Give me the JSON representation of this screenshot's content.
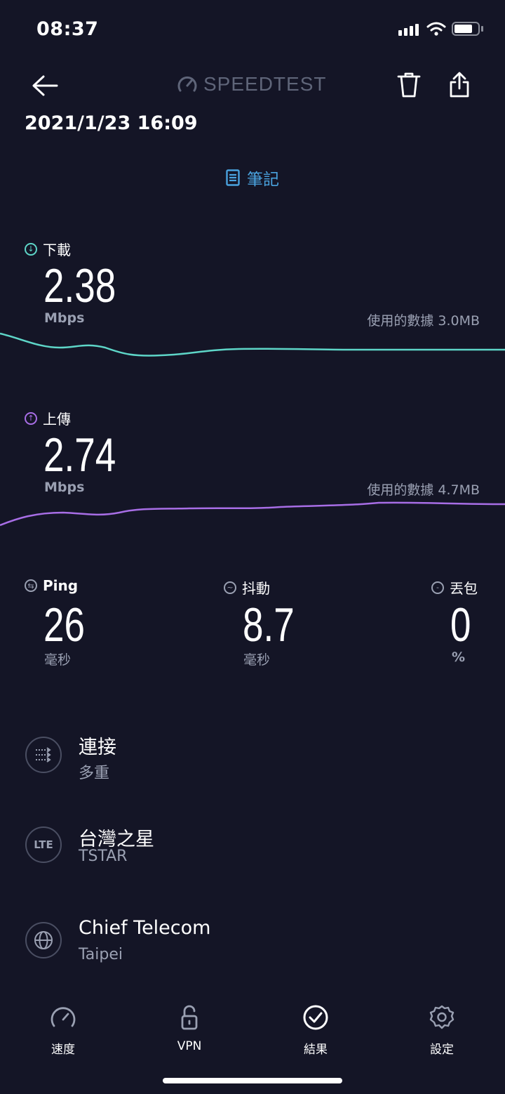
{
  "status_bar": {
    "time": "08:37"
  },
  "header": {
    "logo_text": "SPEEDTEST",
    "datetime": "2021/1/23 16:09",
    "notes_label": "筆記"
  },
  "download": {
    "label": "下載",
    "value": "2.38",
    "unit": "Mbps",
    "data_used": "使用的數據 3.0MB",
    "color": "#5ed6c8"
  },
  "upload": {
    "label": "上傳",
    "value": "2.74",
    "unit": "Mbps",
    "data_used": "使用的數據 4.7MB",
    "color": "#a86ee6"
  },
  "ping": {
    "label": "Ping",
    "value": "26",
    "unit": "毫秒"
  },
  "jitter": {
    "label": "抖動",
    "value": "8.7",
    "unit": "毫秒"
  },
  "packet_loss": {
    "label": "丟包",
    "value": "0",
    "unit": "%"
  },
  "connection": {
    "title": "連接",
    "subtitle": "多重"
  },
  "carrier": {
    "icon_text": "LTE",
    "title": "台灣之星",
    "subtitle": "TSTAR"
  },
  "server": {
    "title": "Chief Telecom",
    "subtitle": "Taipei"
  },
  "tabs": [
    {
      "label": "速度",
      "icon": "speedometer-icon"
    },
    {
      "label": "VPN",
      "icon": "lock-icon"
    },
    {
      "label": "結果",
      "icon": "check-circle-icon",
      "active": true
    },
    {
      "label": "設定",
      "icon": "gear-icon"
    }
  ]
}
